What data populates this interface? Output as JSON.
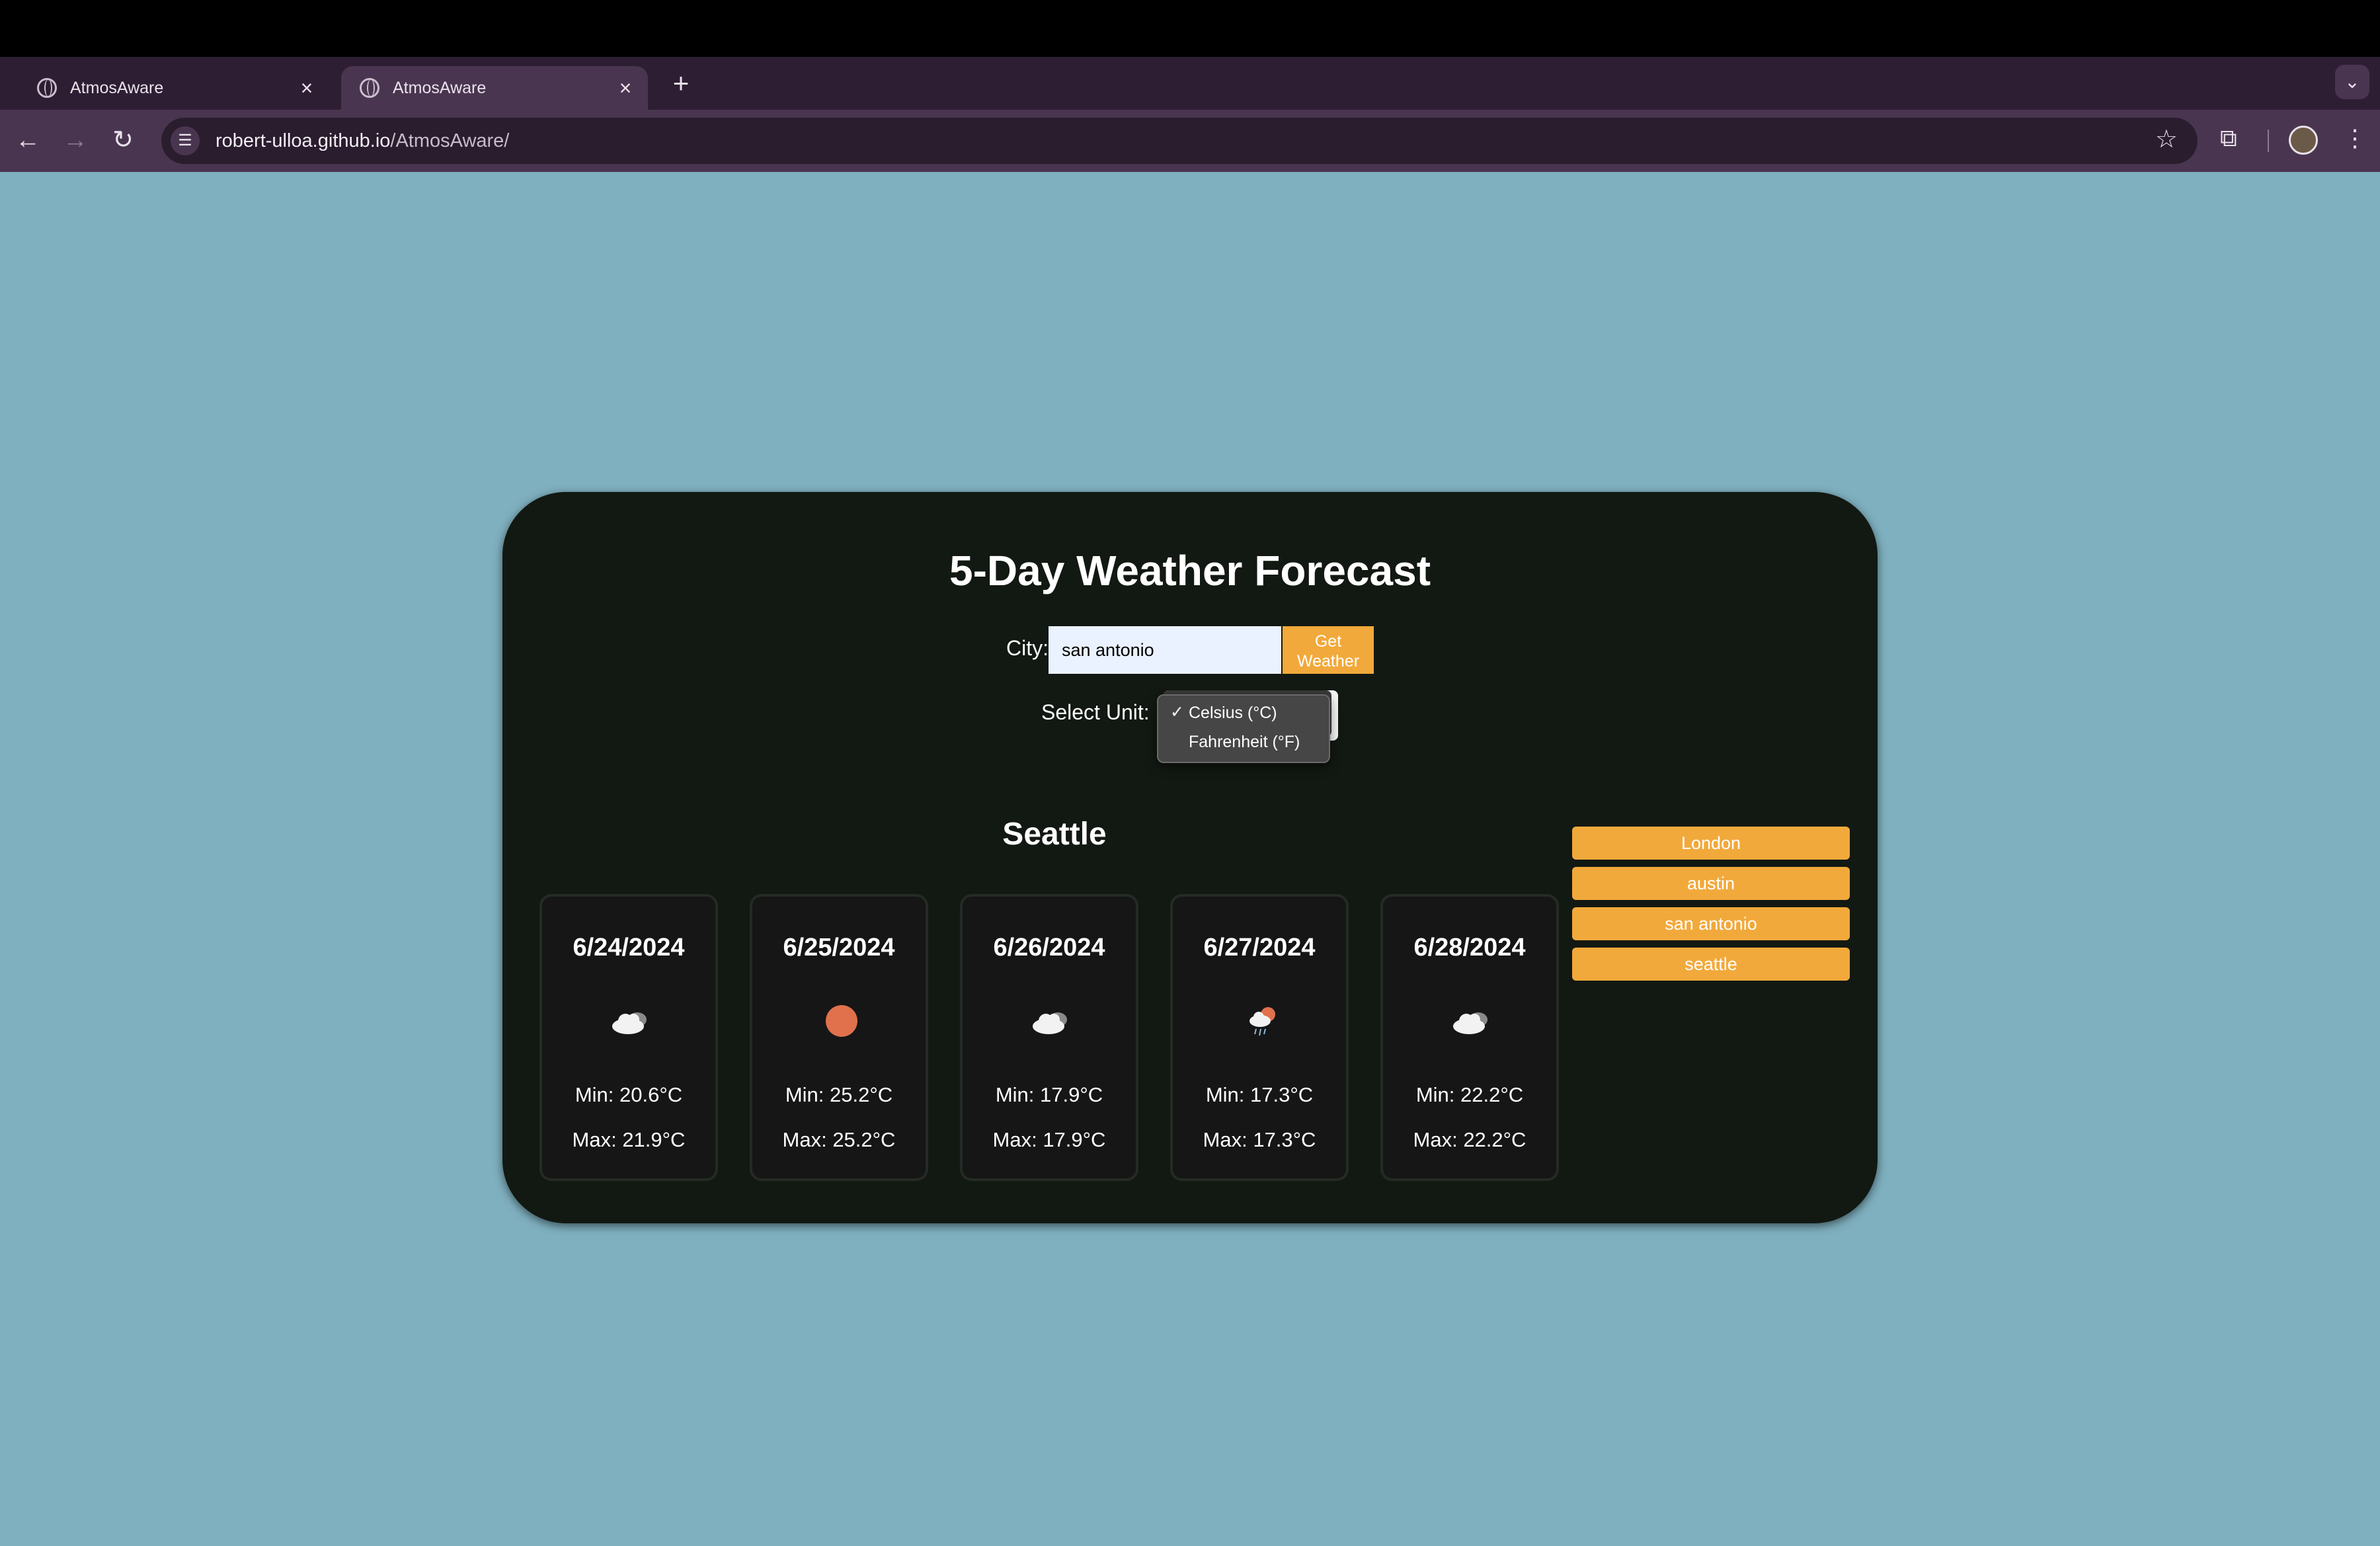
{
  "browser": {
    "tabs": [
      {
        "title": "AtmosAware",
        "active": false
      },
      {
        "title": "AtmosAware",
        "active": true
      }
    ],
    "url_host": "robert-ulloa.github.io",
    "url_path": "/AtmosAware/"
  },
  "app": {
    "heading": "5-Day Weather Forecast",
    "city_label": "City:",
    "city_value": "san antonio",
    "get_button": "Get\nWeather",
    "unit_label": "Select Unit:",
    "unit_options": [
      "Celsius (°C)",
      "Fahrenheit (°F)"
    ],
    "selected_unit": "Celsius (°C)",
    "city_name": "Seattle",
    "forecast": [
      {
        "date": "6/24/2024",
        "icon": "cloud-icon",
        "min": "Min: 20.6°C",
        "max": "Max: 21.9°C"
      },
      {
        "date": "6/25/2024",
        "icon": "sun-icon",
        "min": "Min: 25.2°C",
        "max": "Max: 25.2°C"
      },
      {
        "date": "6/26/2024",
        "icon": "cloud-icon",
        "min": "Min: 17.9°C",
        "max": "Max: 17.9°C"
      },
      {
        "date": "6/27/2024",
        "icon": "rain-sun-icon",
        "min": "Min: 17.3°C",
        "max": "Max: 17.3°C"
      },
      {
        "date": "6/28/2024",
        "icon": "cloud-icon",
        "min": "Min: 22.2°C",
        "max": "Max: 22.2°C"
      }
    ],
    "history": [
      "London",
      "austin",
      "san antonio",
      "seattle"
    ],
    "colors": {
      "accent": "#f2a93b",
      "card": "#121812",
      "background": "#7fb0bf"
    }
  }
}
